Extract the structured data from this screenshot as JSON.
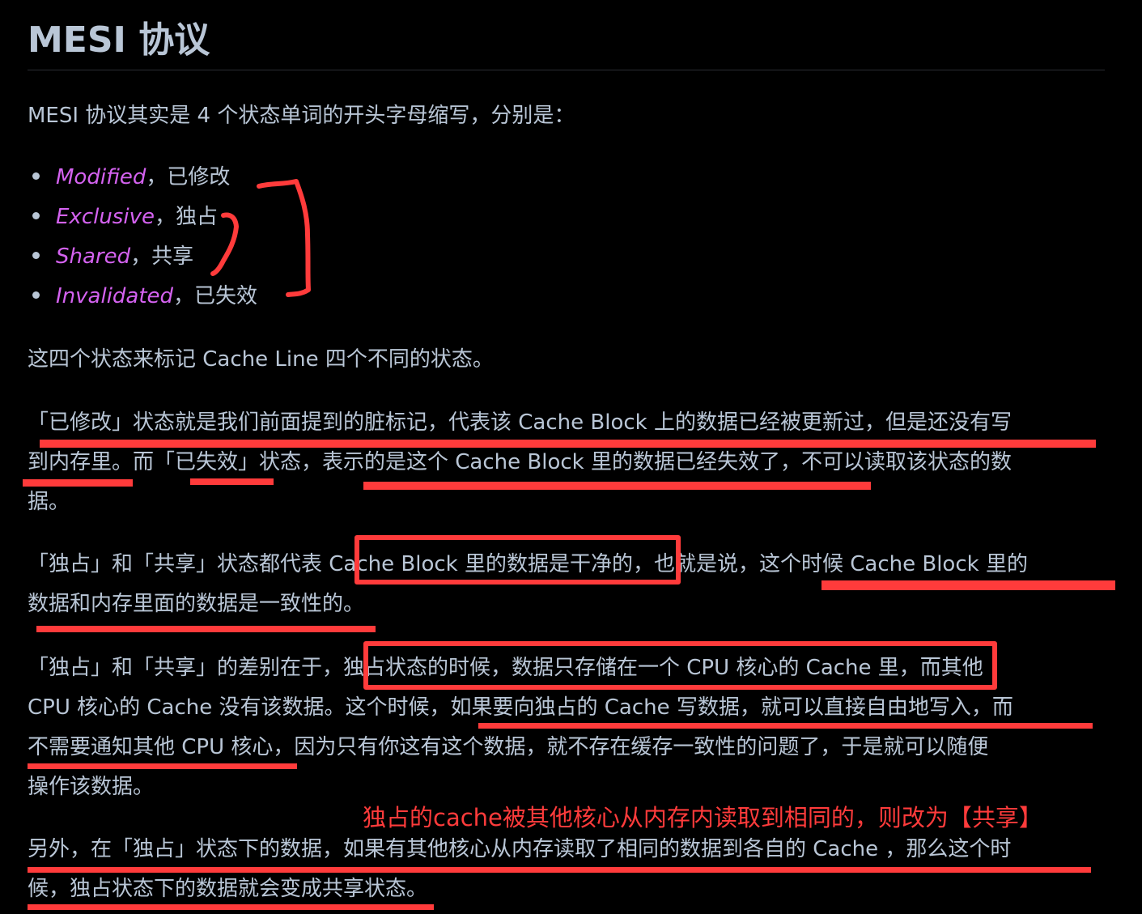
{
  "title": "MESI 协议",
  "intro": "MESI 协议其实是 4 个状态单词的开头字母缩写，分别是：",
  "states": [
    {
      "en": "Modified",
      "zh": "，已修改"
    },
    {
      "en": "Exclusive",
      "zh": "，独占"
    },
    {
      "en": "Shared",
      "zh": "，共享"
    },
    {
      "en": "Invalidated",
      "zh": "，已失效"
    }
  ],
  "summary": "这四个状态来标记 Cache Line 四个不同的状态。",
  "para1": [
    "「已修改」状态就是我们前面提到的脏标记，代表该 Cache Block 上的数据已经被更新过，但是还没有写",
    "到内存里。而「已失效」状态，表示的是这个 Cache Block 里的数据已经失效了，不可以读取该状态的数",
    "据。"
  ],
  "para2": [
    "「独占」和「共享」状态都代表 Cache Block 里的数据是干净的，也就是说，这个时候 Cache Block 里的",
    "数据和内存里面的数据是一致性的。"
  ],
  "para3": [
    "「独占」和「共享」的差别在于，独占状态的时候，数据只存储在一个 CPU 核心的 Cache 里，而其他",
    "CPU 核心的 Cache 没有该数据。这个时候，如果要向独占的 Cache 写数据，就可以直接自由地写入，而",
    "不需要通知其他 CPU 核心，因为只有你这有这个数据，就不存在缓存一致性的问题了，于是就可以随便",
    "操作该数据。"
  ],
  "annotation_note": "独占的cache被其他核心从内存内读取到相同的，则改为【共享】",
  "para4": [
    "另外，在「独占」状态下的数据，如果有其他核心从内存读取了相同的数据到各自的 Cache ，那么这个时",
    "候，独占状态下的数据就会变成共享状态。"
  ],
  "colors": {
    "background": "#000000",
    "text": "#b9c6d6",
    "emphasis": "#d462f0",
    "annotation": "#ff3b3b"
  }
}
